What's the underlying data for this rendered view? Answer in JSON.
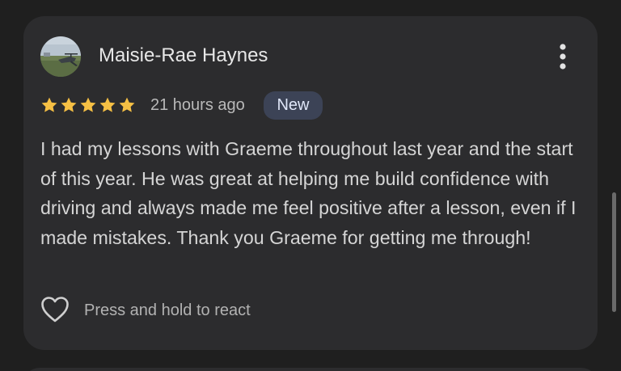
{
  "review": {
    "reviewer_name": "Maisie-Rae Haynes",
    "rating": 5,
    "rating_max": 5,
    "timestamp": "21 hours ago",
    "badge": "New",
    "text": "I had my lessons with Graeme throughout last year and the start of this year. He was great at helping me build confidence with driving and always made me feel positive after a lesson, even if I made mistakes. Thank you Graeme for getting me through!",
    "react_prompt": "Press and hold to react"
  },
  "icons": {
    "menu": "more-vert-icon",
    "react": "heart-outline-icon",
    "star": "star-icon"
  },
  "colors": {
    "star": "#f6c044",
    "badge_bg": "#3c4356",
    "card_bg": "#2c2c2e",
    "page_bg": "#1f1f1f"
  }
}
